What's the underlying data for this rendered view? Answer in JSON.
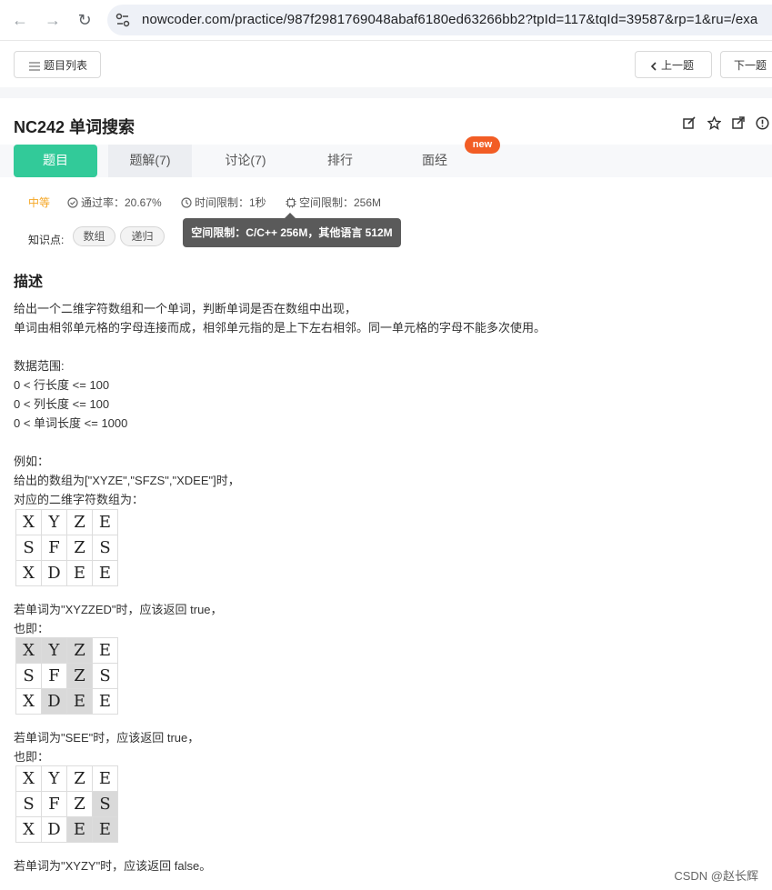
{
  "browser": {
    "url": "nowcoder.com/practice/987f2981769048abaf6180ed63266bb2?tpId=117&tqId=39587&rp=1&ru=/exa"
  },
  "toolbar": {
    "list_label": "题目列表",
    "prev_label": "上一题",
    "next_label": "下一题"
  },
  "problem": {
    "title": "NC242  单词搜索"
  },
  "tabs": [
    {
      "label": "题目"
    },
    {
      "label": "题解(7)"
    },
    {
      "label": "讨论(7)"
    },
    {
      "label": "排行"
    },
    {
      "label": "面经"
    }
  ],
  "new_badge": "new",
  "meta": {
    "difficulty": "中等",
    "pass_rate": "通过率：20.67%",
    "time_limit": "时间限制：1秒",
    "memory_limit": "空间限制：256M",
    "tooltip": "空间限制：C/C++ 256M，其他语言 512M"
  },
  "knowledge": {
    "label": "知识点:",
    "tags": [
      "数组",
      "递归"
    ]
  },
  "description": {
    "heading": "描述",
    "lines": [
      "给出一个二维字符数组和一个单词，判断单词是否在数组中出现，",
      "单词由相邻单元格的字母连接而成，相邻单元指的是上下左右相邻。同一单元格的字母不能多次使用。",
      "数据范围:",
      "0 < 行长度 <= 100",
      "0 < 列长度 <= 100",
      "0 < 单词长度 <= 1000",
      "例如：",
      "给出的数组为[\"XYZE\",\"SFZS\",\"XDEE\"]时，",
      "对应的二维字符数组为：",
      "若单词为\"XYZZED\"时，应该返回 true，",
      "也即：",
      "若单词为\"SEE\"时，应该返回 true，",
      "也即：",
      "若单词为\"XYZY\"时，应该返回 false。"
    ]
  },
  "grids": [
    {
      "rows": [
        [
          "X",
          "Y",
          "Z",
          "E"
        ],
        [
          "S",
          "F",
          "Z",
          "S"
        ],
        [
          "X",
          "D",
          "E",
          "E"
        ]
      ],
      "highlight": []
    },
    {
      "rows": [
        [
          "X",
          "Y",
          "Z",
          "E"
        ],
        [
          "S",
          "F",
          "Z",
          "S"
        ],
        [
          "X",
          "D",
          "E",
          "E"
        ]
      ],
      "highlight": [
        [
          0,
          0
        ],
        [
          0,
          1
        ],
        [
          0,
          2
        ],
        [
          1,
          2
        ],
        [
          2,
          1
        ],
        [
          2,
          2
        ]
      ]
    },
    {
      "rows": [
        [
          "X",
          "Y",
          "Z",
          "E"
        ],
        [
          "S",
          "F",
          "Z",
          "S"
        ],
        [
          "X",
          "D",
          "E",
          "E"
        ]
      ],
      "highlight": [
        [
          1,
          3
        ],
        [
          2,
          2
        ],
        [
          2,
          3
        ]
      ]
    }
  ],
  "watermark": "CSDN @赵长辉"
}
